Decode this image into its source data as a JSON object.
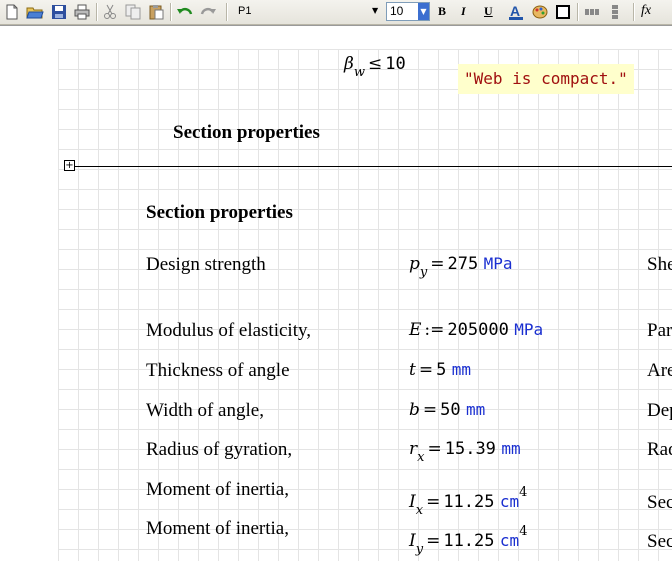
{
  "toolbar": {
    "style_value": "P1",
    "font_size": "10",
    "bold": "B",
    "italic": "I",
    "underline": "U",
    "formula_label": "fx"
  },
  "worksheet": {
    "beta_w": {
      "symbol": "β",
      "sub": "w",
      "op": "≤",
      "value": "10"
    },
    "compact_text": "\"Web is compact.\"",
    "region_heading": "Section properties",
    "section_heading": "Section properties",
    "rows": [
      {
        "label": "Design strength",
        "sym": "p",
        "sub": "y",
        "op": "=",
        "value": "275",
        "unit": "MPa",
        "sup": "",
        "right": "She"
      },
      {
        "label": "Modulus of  elasticity,",
        "sym": "E",
        "sub": "",
        "op": ":=",
        "value": "205000",
        "unit": "MPa",
        "sup": "",
        "right": "Par"
      },
      {
        "label": "Thickness of angle",
        "sym": "t",
        "sub": "",
        "op": "=",
        "value": "5",
        "unit": "mm",
        "sup": "",
        "right": "Are"
      },
      {
        "label": "Width of angle,",
        "sym": "b",
        "sub": "",
        "op": "=",
        "value": "50",
        "unit": "mm",
        "sup": "",
        "right": "Dep"
      },
      {
        "label": "Radius of gyration,",
        "sym": "r",
        "sub": "x",
        "op": "=",
        "value": "15.39",
        "unit": "mm",
        "sup": "",
        "right": "Rad"
      },
      {
        "label": "Moment of inertia,",
        "sym": "I",
        "sub": "x",
        "op": "=",
        "value": "11.25",
        "unit": "cm",
        "sup": "4",
        "right": "Sec"
      },
      {
        "label": "Moment of inertia,",
        "sym": "I",
        "sub": "y",
        "op": "=",
        "value": "11.25",
        "unit": "cm",
        "sup": "4",
        "right": "Sec"
      }
    ]
  }
}
